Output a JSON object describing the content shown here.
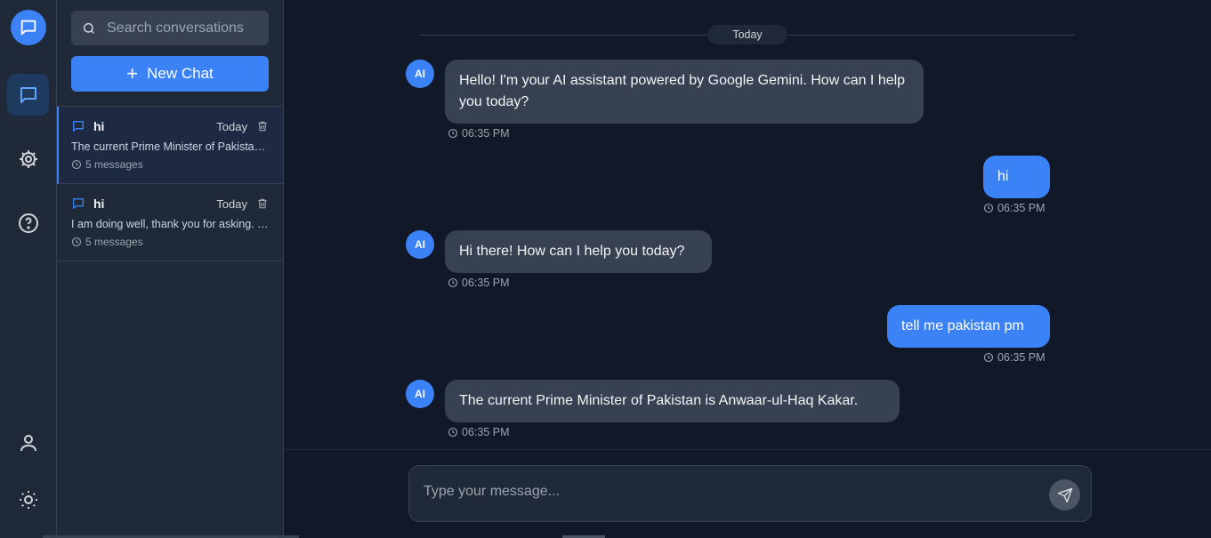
{
  "search": {
    "placeholder": "Search conversations"
  },
  "new_chat_label": "New Chat",
  "conversations": [
    {
      "title": "hi",
      "date": "Today",
      "preview": "The current Prime Minister of Pakistan is Anwaar-ul-Haq Kakar.",
      "count": "5 messages",
      "selected": true
    },
    {
      "title": "hi",
      "date": "Today",
      "preview": "I am doing well, thank you for asking. How can I help you?",
      "count": "5 messages",
      "selected": false
    }
  ],
  "chat": {
    "date_divider": "Today",
    "messages": [
      {
        "role": "ai",
        "avatar": "AI",
        "text": "Hello! I'm your AI assistant powered by Google Gemini. How can I help you today?",
        "time": "06:35 PM"
      },
      {
        "role": "user",
        "text": "hi",
        "time": "06:35 PM"
      },
      {
        "role": "ai",
        "avatar": "AI",
        "text": "Hi there! How can I help you today?",
        "time": "06:35 PM"
      },
      {
        "role": "user",
        "text": "tell me pakistan pm",
        "time": "06:35 PM"
      },
      {
        "role": "ai",
        "avatar": "AI",
        "text": "The current Prime Minister of Pakistan is Anwaar-ul-Haq Kakar.",
        "time": "06:35 PM"
      }
    ]
  },
  "composer": {
    "placeholder": "Type your message..."
  },
  "colors": {
    "accent": "#3b82f6",
    "background": "#111827",
    "panel": "#1f2937",
    "ai_bubble": "#374151"
  },
  "icons": [
    "chat-logo-icon",
    "chat-icon",
    "gear-icon",
    "help-icon",
    "user-icon",
    "sun-icon",
    "search-icon",
    "plus-icon",
    "trash-icon",
    "clock-icon",
    "send-icon"
  ]
}
